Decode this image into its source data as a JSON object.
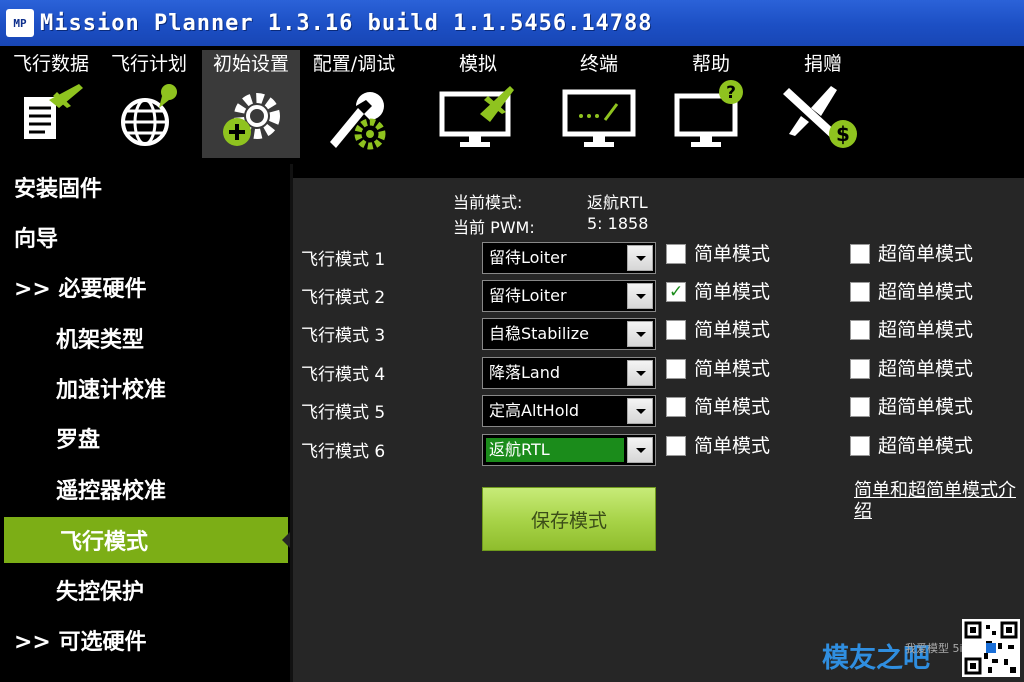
{
  "window": {
    "logo_text": "MP",
    "title": "Mission Planner 1.3.16 build 1.1.5456.14788"
  },
  "menu": [
    {
      "label": "飞行数据",
      "icon": "flight-data-icon"
    },
    {
      "label": "飞行计划",
      "icon": "flight-plan-icon"
    },
    {
      "label": "初始设置",
      "icon": "initial-setup-icon"
    },
    {
      "label": "配置/调试",
      "icon": "config-tuning-icon"
    },
    {
      "label": "模拟",
      "icon": "simulation-icon"
    },
    {
      "label": "终端",
      "icon": "terminal-icon"
    },
    {
      "label": "帮助",
      "icon": "help-icon"
    },
    {
      "label": "捐赠",
      "icon": "donate-icon"
    }
  ],
  "nav": [
    {
      "label": "安装固件"
    },
    {
      "label": "向导"
    },
    {
      "label": ">> 必要硬件"
    },
    {
      "label": "机架类型"
    },
    {
      "label": "加速计校准"
    },
    {
      "label": "罗盘"
    },
    {
      "label": "遥控器校准"
    },
    {
      "label": "飞行模式"
    },
    {
      "label": "失控保护"
    },
    {
      "label": ">> 可选硬件"
    }
  ],
  "status": {
    "current_mode_label": "当前模式:",
    "current_mode_value": "返航RTL",
    "current_pwm_label": "当前 PWM:",
    "current_pwm_value": "5: 1858"
  },
  "modes": [
    {
      "label": "飞行模式 1",
      "value": "留待Loiter",
      "simple": false,
      "super_simple": false
    },
    {
      "label": "飞行模式 2",
      "value": "留待Loiter",
      "simple": true,
      "super_simple": false
    },
    {
      "label": "飞行模式 3",
      "value": "自稳Stabilize",
      "simple": false,
      "super_simple": false
    },
    {
      "label": "飞行模式 4",
      "value": "降落Land",
      "simple": false,
      "super_simple": false
    },
    {
      "label": "飞行模式 5",
      "value": "定高AltHold",
      "simple": false,
      "super_simple": false
    },
    {
      "label": "飞行模式 6",
      "value": "返航RTL",
      "simple": false,
      "super_simple": false
    }
  ],
  "labels": {
    "simple_mode": "简单模式",
    "super_simple_mode": "超简单模式",
    "check_mark": "✓",
    "save_button": "保存模式",
    "help_link": "简单和超简单模式介绍"
  },
  "watermark": {
    "brand": "模友之吧",
    "sub": "我爱模型 5iMX"
  },
  "colors": {
    "title_bar": "#1c4fc4",
    "active_nav": "#7cae16",
    "highlight_combo": "#1b8c1b",
    "icon_green": "#8fc31f"
  }
}
